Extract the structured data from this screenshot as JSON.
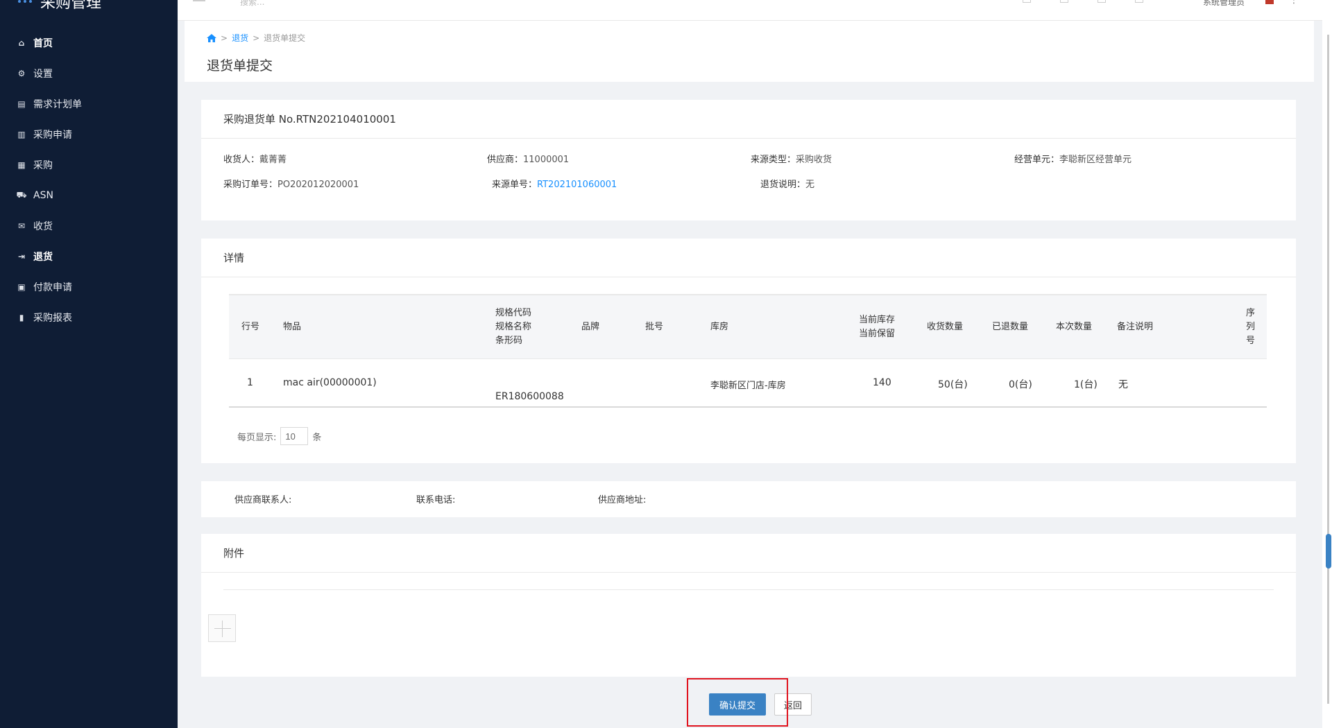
{
  "app": {
    "title": "采购管理"
  },
  "header": {
    "search_placeholder": "搜索...",
    "user": "系统管理员"
  },
  "sidebar": {
    "items": [
      {
        "label": "首页",
        "icon": "home-icon"
      },
      {
        "label": "设置",
        "icon": "gear-icon"
      },
      {
        "label": "需求计划单",
        "icon": "doc-icon"
      },
      {
        "label": "采购申请",
        "icon": "list-icon"
      },
      {
        "label": "采购",
        "icon": "cart-icon"
      },
      {
        "label": "ASN",
        "icon": "truck-icon"
      },
      {
        "label": "收货",
        "icon": "inbox-icon"
      },
      {
        "label": "退货",
        "icon": "return-icon"
      },
      {
        "label": "付款申请",
        "icon": "payment-icon"
      },
      {
        "label": "采购报表",
        "icon": "chart-icon"
      }
    ]
  },
  "breadcrumb": {
    "sep": ">",
    "link": "退货",
    "current": "退货单提交"
  },
  "page_title": "退货单提交",
  "order": {
    "title": "采购退货单 No.RTN202104010001",
    "receiver_label": "收货人：",
    "receiver": "戴菁菁",
    "supplier_label": "供应商：",
    "supplier": "11000001",
    "source_type_label": "来源类型：",
    "source_type": "采购收货",
    "unit_label": "经营单元：",
    "unit": "李聪新区经营单元",
    "po_label": "采购订单号：",
    "po": "PO202012020001",
    "source_no_label": "来源单号：",
    "source_no": "RT202101060001",
    "note_label": "退货说明：",
    "note": "无"
  },
  "details": {
    "title": "详情",
    "headers": {
      "line": "行号",
      "item": "物品",
      "spec1": "规格代码",
      "spec2": "规格名称",
      "spec3": "条形码",
      "brand": "品牌",
      "batch": "批号",
      "warehouse": "库房",
      "stock1": "当前库存",
      "stock2": "当前保留",
      "received": "收货数量",
      "returned": "已退数量",
      "this_qty": "本次数量",
      "remark": "备注说明",
      "serial1": "序",
      "serial2": "列",
      "serial3": "号"
    },
    "rows": [
      {
        "line": "1",
        "item": "mac air(00000001)",
        "barcode": "ER180600088",
        "warehouse": "李聪新区门店-库房",
        "stock": "140",
        "received": "50(台)",
        "returned": "0(台)",
        "this_qty": "1(台)",
        "remark": "无"
      }
    ],
    "pager": {
      "prefix": "每页显示:",
      "value": "10",
      "suffix": "条"
    }
  },
  "contact": {
    "person_label": "供应商联系人:",
    "phone_label": "联系电话:",
    "address_label": "供应商地址:"
  },
  "attachments": {
    "title": "附件"
  },
  "buttons": {
    "confirm": "确认提交",
    "back": "返回"
  },
  "colors": {
    "sidebar": "#0f1d35",
    "primary": "#3a82c4",
    "link": "#1890ff",
    "highlight": "#e0131e"
  }
}
